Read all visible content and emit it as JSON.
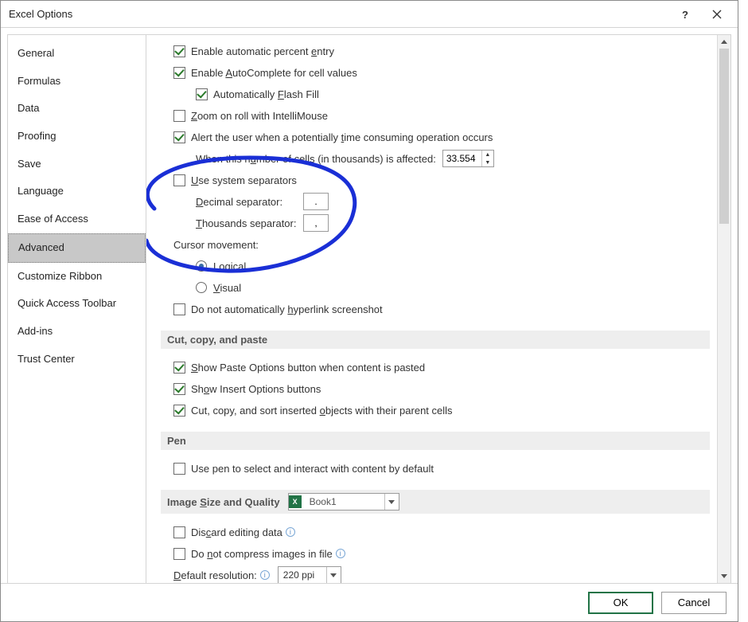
{
  "window": {
    "title": "Excel Options"
  },
  "sidebar": {
    "items": [
      {
        "label": "General"
      },
      {
        "label": "Formulas"
      },
      {
        "label": "Data"
      },
      {
        "label": "Proofing"
      },
      {
        "label": "Save"
      },
      {
        "label": "Language"
      },
      {
        "label": "Ease of Access"
      },
      {
        "label": "Advanced",
        "selected": true
      },
      {
        "label": "Customize Ribbon"
      },
      {
        "label": "Quick Access Toolbar"
      },
      {
        "label": "Add-ins"
      },
      {
        "label": "Trust Center"
      }
    ]
  },
  "options": {
    "enable_percent": "Enable automatic percent entry",
    "enable_autocomplete": "Enable AutoComplete for cell values",
    "auto_flashfill": "Automatically Flash Fill",
    "zoom_intelli": "Zoom on roll with IntelliMouse",
    "alert_time": "Alert the user when a potentially time consuming operation occurs",
    "when_number_label": "When this number of cells (in thousands) is affected:",
    "when_number_value": "33.554",
    "use_system_sep": "Use system separators",
    "decimal_sep_label": "Decimal separator:",
    "decimal_sep_value": ".",
    "thousands_sep_label": "Thousands separator:",
    "thousands_sep_value": ",",
    "cursor_movement": "Cursor movement:",
    "radio_logical": "Logical",
    "radio_visual": "Visual",
    "no_auto_hyperlink": "Do not automatically hyperlink screenshot"
  },
  "sections": {
    "ccp": "Cut, copy, and paste",
    "ccp_paste_options": "Show Paste Options button when content is pasted",
    "ccp_insert_options": "Show Insert Options buttons",
    "ccp_sort_objects": "Cut, copy, and sort inserted objects with their parent cells",
    "pen": "Pen",
    "pen_use": "Use pen to select and interact with content by default",
    "image": "Image Size and Quality",
    "image_book": "Book1",
    "discard_edit": "Discard editing data",
    "no_compress": "Do not compress images in file",
    "default_res_label": "Default resolution:",
    "default_res_value": "220 ppi"
  },
  "footer": {
    "ok": "OK",
    "cancel": "Cancel"
  }
}
